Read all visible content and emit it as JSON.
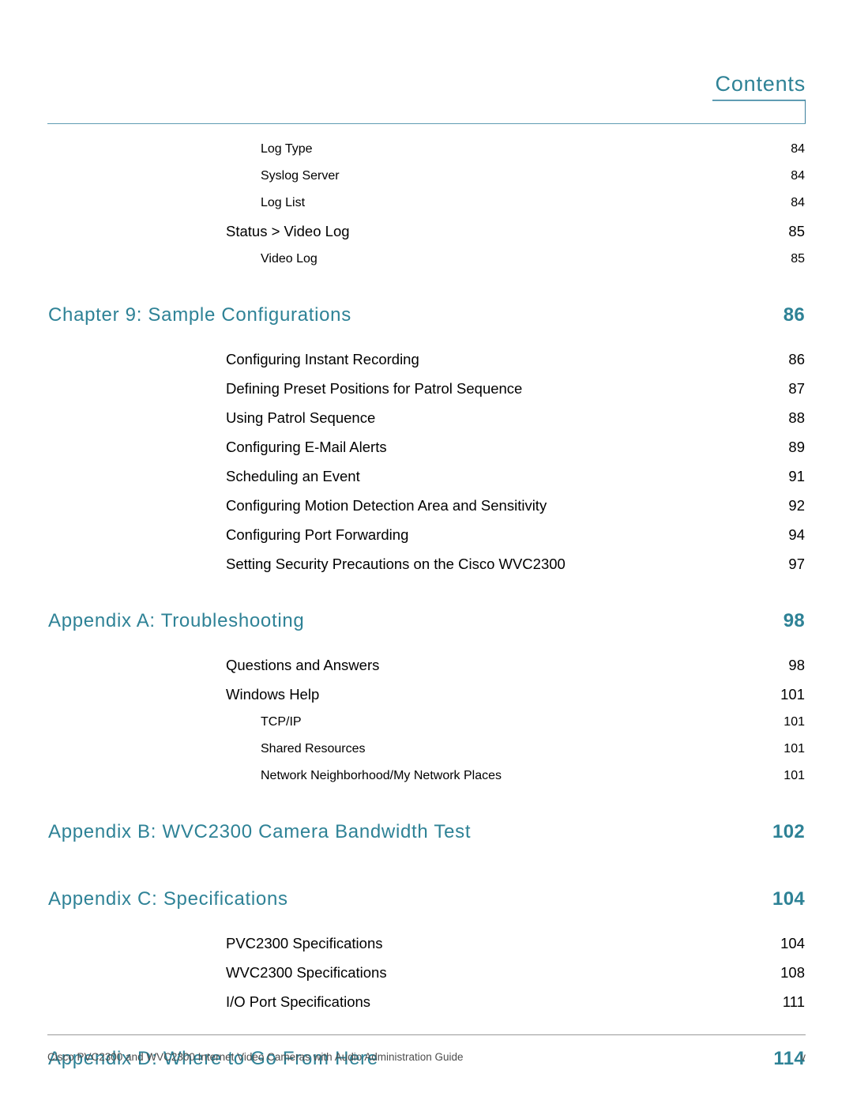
{
  "document": {
    "header_title": "Contents",
    "accent_color": "#2e8296",
    "rule_color": "#5f9cb3",
    "body_text_color": "#000000",
    "footer_text_color": "#4d4d4d"
  },
  "toc": {
    "entries": [
      {
        "level": 3,
        "label": "Log Type",
        "page": "84"
      },
      {
        "level": 3,
        "label": "Syslog Server",
        "page": "84"
      },
      {
        "level": 3,
        "label": "Log List",
        "page": "84"
      },
      {
        "level": 2,
        "label": "Status > Video Log",
        "page": "85"
      },
      {
        "level": 3,
        "label": "Video Log",
        "page": "85"
      },
      {
        "level": 1,
        "label": "Chapter 9: Sample Configurations",
        "page": "86"
      },
      {
        "level": 2,
        "label": "Configuring Instant Recording",
        "page": "86"
      },
      {
        "level": 2,
        "label": "Defining Preset Positions for Patrol Sequence",
        "page": "87"
      },
      {
        "level": 2,
        "label": "Using Patrol Sequence",
        "page": "88"
      },
      {
        "level": 2,
        "label": "Configuring E-Mail Alerts",
        "page": "89"
      },
      {
        "level": 2,
        "label": "Scheduling an Event",
        "page": "91"
      },
      {
        "level": 2,
        "label": "Configuring Motion Detection Area and Sensitivity",
        "page": "92"
      },
      {
        "level": 2,
        "label": "Configuring Port Forwarding",
        "page": "94"
      },
      {
        "level": 2,
        "label": "Setting Security Precautions on the Cisco WVC2300",
        "page": "97"
      },
      {
        "level": 1,
        "label": "Appendix A: Troubleshooting",
        "page": "98"
      },
      {
        "level": 2,
        "label": "Questions and Answers",
        "page": "98"
      },
      {
        "level": 2,
        "label": "Windows Help",
        "page": "101"
      },
      {
        "level": 3,
        "label": "TCP/IP",
        "page": "101"
      },
      {
        "level": 3,
        "label": "Shared Resources",
        "page": "101"
      },
      {
        "level": 3,
        "label": "Network Neighborhood/My Network Places",
        "page": "101"
      },
      {
        "level": 1,
        "label": "Appendix B: WVC2300 Camera Bandwidth Test",
        "page": "102"
      },
      {
        "level": 1,
        "label": "Appendix C: Specifications",
        "page": "104"
      },
      {
        "level": 2,
        "label": "PVC2300 Specifications",
        "page": "104"
      },
      {
        "level": 2,
        "label": "WVC2300 Specifications",
        "page": "108"
      },
      {
        "level": 2,
        "label": "I/O Port Specifications",
        "page": "111"
      },
      {
        "level": 1,
        "label": "Appendix D: Where to Go From Here",
        "page": "114"
      }
    ]
  },
  "footer": {
    "text": "Cisco PVC2300 and WVC2300 Internet Video Cameras with Audio Administration Guide",
    "page_number": "v"
  }
}
